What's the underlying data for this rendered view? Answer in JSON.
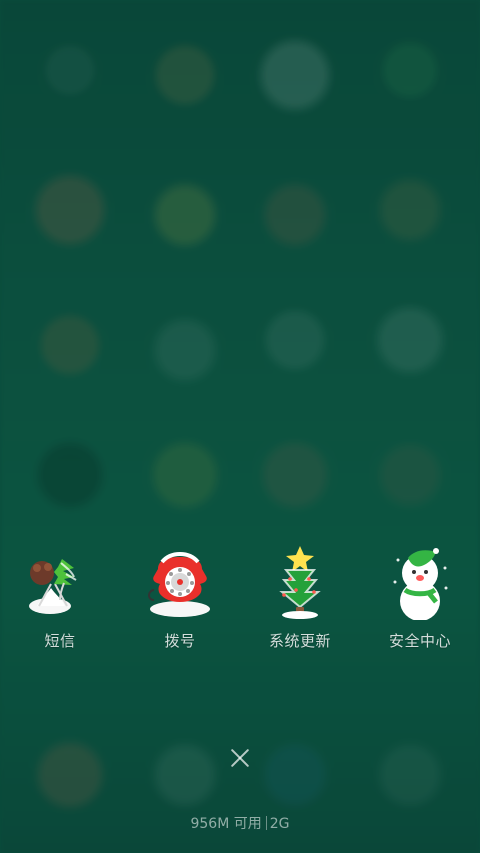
{
  "apps": [
    {
      "label": "短信",
      "icon": "messages-icon"
    },
    {
      "label": "拨号",
      "icon": "phone-icon"
    },
    {
      "label": "系统更新",
      "icon": "system-update-icon"
    },
    {
      "label": "安全中心",
      "icon": "security-center-icon"
    }
  ],
  "footer": {
    "close_icon": "close-icon",
    "memory_text": "956M 可用",
    "network_text": "2G"
  }
}
